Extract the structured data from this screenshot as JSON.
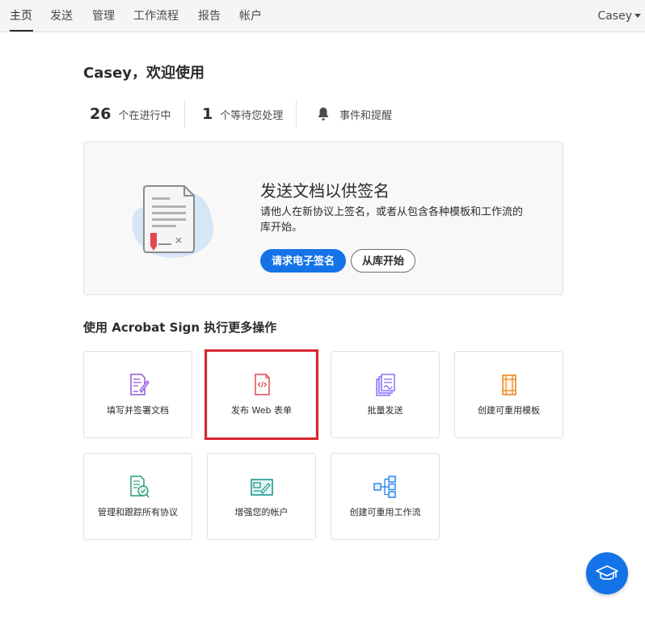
{
  "nav": {
    "items": [
      {
        "label": "主页",
        "active": true
      },
      {
        "label": "发送"
      },
      {
        "label": "管理"
      },
      {
        "label": "工作流程"
      },
      {
        "label": "报告"
      },
      {
        "label": "帐户"
      }
    ],
    "user": "Casey"
  },
  "welcome": "Casey，欢迎使用",
  "stats": {
    "in_progress": {
      "count": "26",
      "label": "个在进行中"
    },
    "waiting": {
      "count": "1",
      "label": "个等待您处理"
    },
    "events": {
      "label": "事件和提醒"
    }
  },
  "hero": {
    "title": "发送文档以供签名",
    "description": "请他人在新协议上签名，或者从包含各种模板和工作流的库开始。",
    "primary_button": "请求电子签名",
    "secondary_button": "从库开始"
  },
  "section_title": "使用 Acrobat Sign 执行更多操作",
  "tiles": [
    {
      "label": "填写并签署文档",
      "icon": "fill-sign-icon",
      "color": "#9256d9"
    },
    {
      "label": "发布 Web 表单",
      "icon": "web-form-icon",
      "color": "#e34850",
      "highlighted": true
    },
    {
      "label": "批量发送",
      "icon": "bulk-send-icon",
      "color": "#7b61ff"
    },
    {
      "label": "创建可重用模板",
      "icon": "template-icon",
      "color": "#e68619"
    },
    {
      "label": "管理和跟踪所有协议",
      "icon": "manage-track-icon",
      "color": "#2d9d78"
    },
    {
      "label": "增强您的帐户",
      "icon": "enhance-account-icon",
      "color": "#0d9488"
    },
    {
      "label": "创建可重用工作流",
      "icon": "workflow-icon",
      "color": "#2680eb"
    }
  ],
  "colors": {
    "accent": "#1473e6",
    "highlight_box": "#d7262f"
  }
}
